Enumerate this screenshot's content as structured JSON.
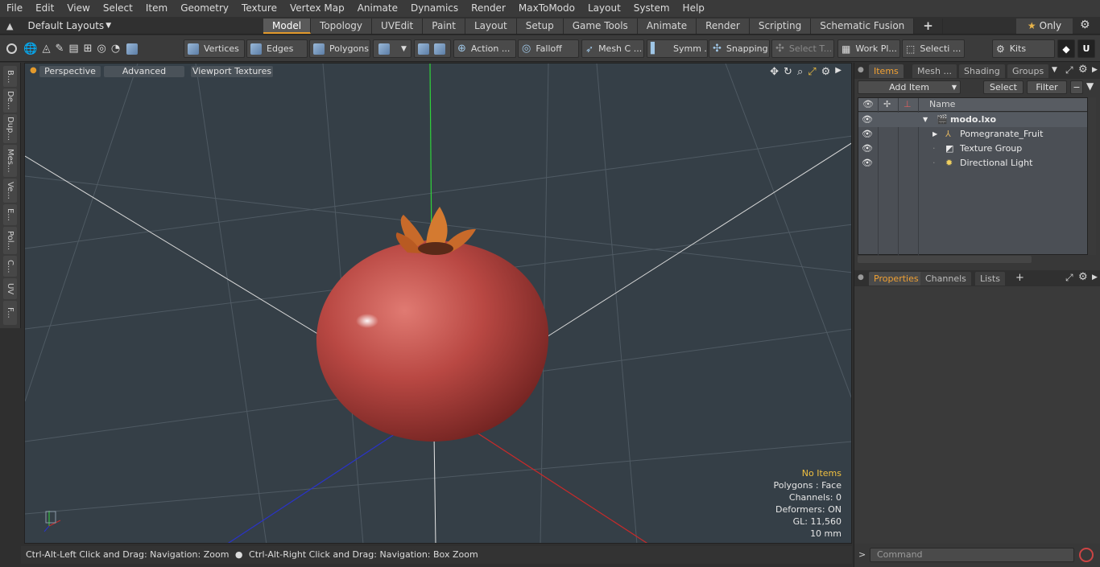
{
  "menu": [
    "File",
    "Edit",
    "View",
    "Select",
    "Item",
    "Geometry",
    "Texture",
    "Vertex Map",
    "Animate",
    "Dynamics",
    "Render",
    "MaxToModo",
    "Layout",
    "System",
    "Help"
  ],
  "layout_select": "Default Layouts",
  "layout_tabs": [
    "Model",
    "Topology",
    "UVEdit",
    "Paint",
    "Layout",
    "Setup",
    "Game Tools",
    "Animate",
    "Render",
    "Scripting",
    "Schematic Fusion"
  ],
  "active_layout_tab": "Model",
  "only_label": "Only",
  "toolbar": {
    "vertices": "Vertices",
    "edges": "Edges",
    "polygons": "Polygons",
    "action": "Action ...",
    "falloff": "Falloff",
    "mesh_c": "Mesh C ...",
    "symm": "Symm ...",
    "snapping": "Snapping",
    "select_t": "Select T...",
    "work_pl": "Work Pl...",
    "selecti": "Selecti ...",
    "kits": "Kits"
  },
  "left_tabs": [
    "B...",
    "De...",
    "Dup...",
    "Mes...",
    "Ve...",
    "E...",
    "Pol...",
    "C...",
    "UV",
    "F..."
  ],
  "viewport": {
    "view": "Perspective",
    "shading": "Advanced",
    "textures": "Viewport Textures",
    "info": {
      "selection": "No Items",
      "polygons": "Polygons : Face",
      "channels": "Channels: 0",
      "deformers": "Deformers: ON",
      "gl": "GL: 11,560",
      "scale": "10 mm"
    }
  },
  "panel_top": {
    "tabs": [
      "Items",
      "Mesh ...",
      "Shading",
      "Groups"
    ],
    "active_tab": "Items",
    "add_item": "Add Item",
    "select": "Select",
    "filter": "Filter",
    "name_col": "Name",
    "items": [
      {
        "label": "modo.lxo",
        "level": 0,
        "icon": "scene-icon"
      },
      {
        "label": "Pomegranate_Fruit",
        "level": 1,
        "icon": "mesh-group-icon"
      },
      {
        "label": "Texture Group",
        "level": 1,
        "icon": "texture-group-icon"
      },
      {
        "label": "Directional Light",
        "level": 1,
        "icon": "light-icon"
      }
    ]
  },
  "panel_bottom": {
    "tabs": [
      "Properties",
      "Channels",
      "Lists"
    ],
    "active_tab": "Properties"
  },
  "status": {
    "hint_left": "Ctrl-Alt-Left Click and Drag: Navigation: Zoom",
    "hint_right": "Ctrl-Alt-Right Click and Drag: Navigation: Box Zoom",
    "command_placeholder": "Command"
  },
  "colors": {
    "accent": "#e39a2c",
    "viewport_bg": "#353f47",
    "fruit": "#b94843"
  }
}
